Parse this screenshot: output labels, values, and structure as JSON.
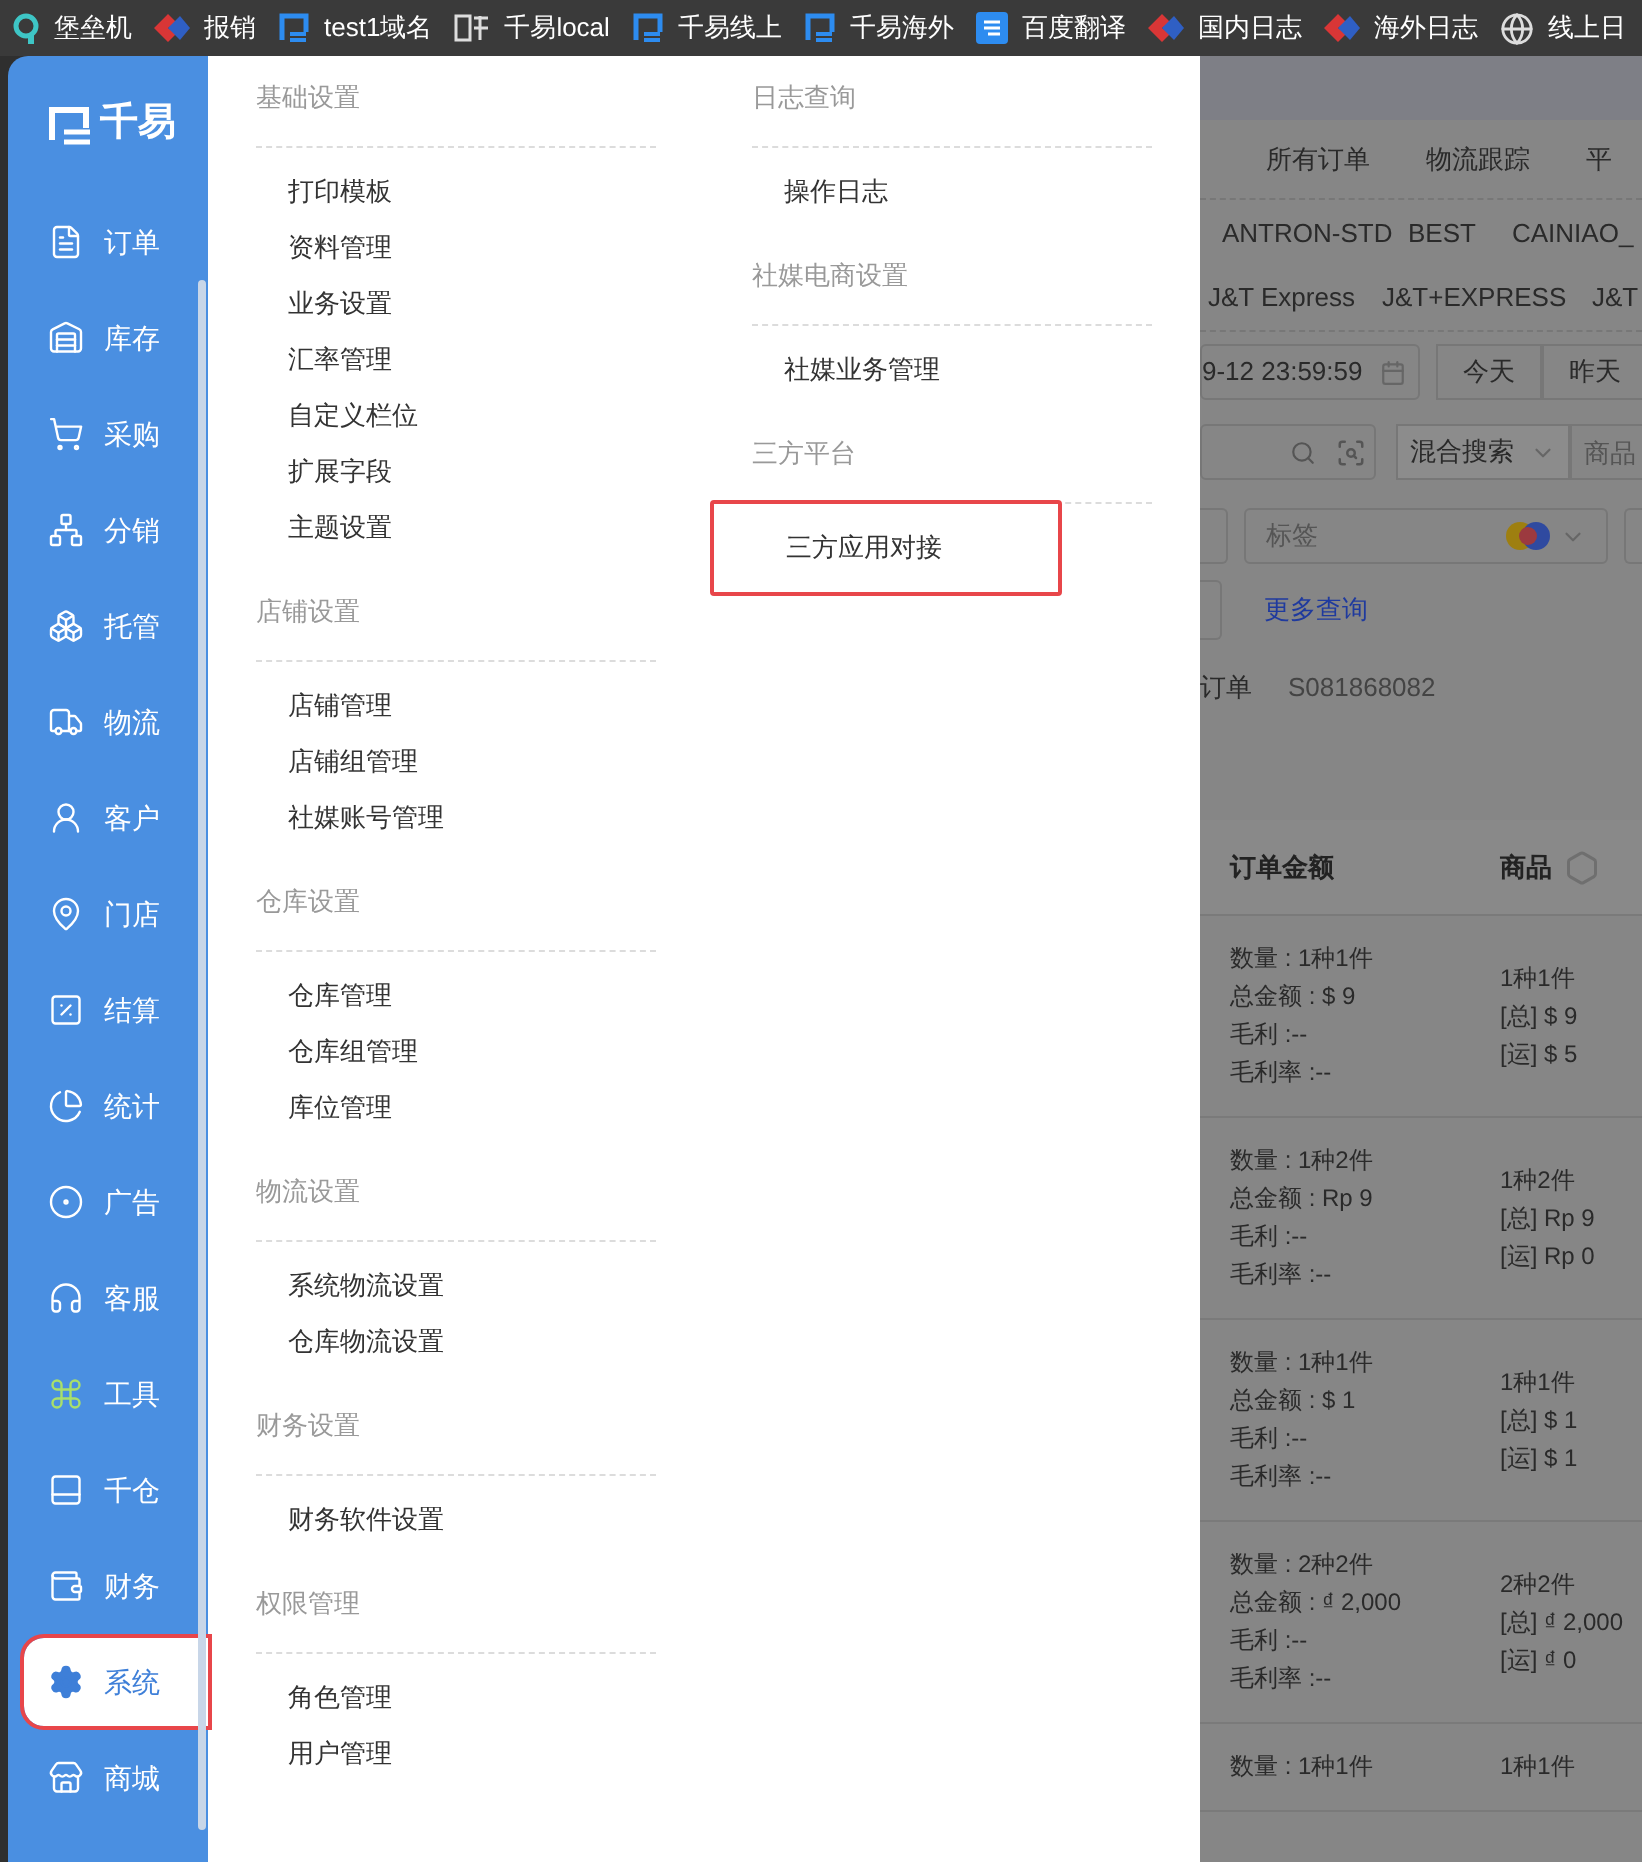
{
  "bookmarks": [
    {
      "label": "堡垒机"
    },
    {
      "label": "报销"
    },
    {
      "label": "test1域名"
    },
    {
      "label": "千易local"
    },
    {
      "label": "千易线上"
    },
    {
      "label": "千易海外"
    },
    {
      "label": "百度翻译"
    },
    {
      "label": "国内日志"
    },
    {
      "label": "海外日志"
    },
    {
      "label": "线上日"
    }
  ],
  "sidebar": {
    "logo": "千易",
    "items": [
      {
        "label": "订单",
        "selected": false,
        "highlighted": false
      },
      {
        "label": "库存",
        "selected": false,
        "highlighted": false
      },
      {
        "label": "采购",
        "selected": false,
        "highlighted": false
      },
      {
        "label": "分销",
        "selected": false,
        "highlighted": false
      },
      {
        "label": "托管",
        "selected": false,
        "highlighted": false
      },
      {
        "label": "物流",
        "selected": false,
        "highlighted": false
      },
      {
        "label": "客户",
        "selected": false,
        "highlighted": false
      },
      {
        "label": "门店",
        "selected": false,
        "highlighted": false
      },
      {
        "label": "结算",
        "selected": false,
        "highlighted": false
      },
      {
        "label": "统计",
        "selected": false,
        "highlighted": false
      },
      {
        "label": "广告",
        "selected": false,
        "highlighted": false
      },
      {
        "label": "客服",
        "selected": false,
        "highlighted": false
      },
      {
        "label": "工具",
        "selected": false,
        "highlighted": false
      },
      {
        "label": "千仓",
        "selected": false,
        "highlighted": false
      },
      {
        "label": "财务",
        "selected": false,
        "highlighted": false
      },
      {
        "label": "系统",
        "selected": true,
        "highlighted": true
      },
      {
        "label": "商城",
        "selected": false,
        "highlighted": false
      }
    ]
  },
  "menu": {
    "columns": [
      {
        "groups": [
          {
            "heading": "基础设置",
            "items": [
              {
                "label": "打印模板",
                "highlighted": false
              },
              {
                "label": "资料管理",
                "highlighted": false
              },
              {
                "label": "业务设置",
                "highlighted": false
              },
              {
                "label": "汇率管理",
                "highlighted": false
              },
              {
                "label": "自定义栏位",
                "highlighted": false
              },
              {
                "label": "扩展字段",
                "highlighted": false
              },
              {
                "label": "主题设置",
                "highlighted": false
              }
            ]
          },
          {
            "heading": "店铺设置",
            "items": [
              {
                "label": "店铺管理",
                "highlighted": false
              },
              {
                "label": "店铺组管理",
                "highlighted": false
              },
              {
                "label": "社媒账号管理",
                "highlighted": false
              }
            ]
          },
          {
            "heading": "仓库设置",
            "items": [
              {
                "label": "仓库管理",
                "highlighted": false
              },
              {
                "label": "仓库组管理",
                "highlighted": false
              },
              {
                "label": "库位管理",
                "highlighted": false
              }
            ]
          },
          {
            "heading": "物流设置",
            "items": [
              {
                "label": "系统物流设置",
                "highlighted": false
              },
              {
                "label": "仓库物流设置",
                "highlighted": false
              }
            ]
          },
          {
            "heading": "财务设置",
            "items": [
              {
                "label": "财务软件设置",
                "highlighted": false
              }
            ]
          },
          {
            "heading": "权限管理",
            "items": [
              {
                "label": "角色管理",
                "highlighted": false
              },
              {
                "label": "用户管理",
                "highlighted": false
              }
            ]
          }
        ]
      },
      {
        "groups": [
          {
            "heading": "日志查询",
            "items": [
              {
                "label": "操作日志",
                "highlighted": false
              }
            ]
          },
          {
            "heading": "社媒电商设置",
            "items": [
              {
                "label": "社媒业务管理",
                "highlighted": false
              }
            ]
          },
          {
            "heading": "三方平台",
            "items": [
              {
                "label": "三方应用对接",
                "highlighted": true
              }
            ]
          }
        ]
      }
    ]
  },
  "content": {
    "tabs": [
      "所有订单",
      "物流跟踪",
      "平"
    ],
    "carriers": [
      [
        "ANTRON-STD",
        "BEST",
        "CAINIAO_"
      ],
      [
        "J&T Express",
        "J&T+EXPRESS",
        "J&T"
      ]
    ],
    "date_field": {
      "value": "9-12 23:59:59"
    },
    "date_buttons": [
      "今天",
      "昨天"
    ],
    "search_mode": "混合搜索",
    "goods_field": {
      "placeholder": "商品"
    },
    "tag_select": {
      "placeholder": "标签"
    },
    "more_link": "更多查询",
    "order_label": "订单",
    "order_no": "S081868082",
    "table": {
      "columns": [
        "订单金额",
        "商品"
      ],
      "rows": [
        {
          "amount": [
            "数量 : 1种1件",
            "总金额 : $ 9",
            "毛利 :--",
            "毛利率 :--"
          ],
          "goods": [
            "1种1件",
            "[总] $ 9",
            "[运] $ 5"
          ]
        },
        {
          "amount": [
            "数量 : 1种2件",
            "总金额 : Rp 9",
            "毛利 :--",
            "毛利率 :--"
          ],
          "goods": [
            "1种2件",
            "[总] Rp 9",
            "[运] Rp 0"
          ]
        },
        {
          "amount": [
            "数量 : 1种1件",
            "总金额 : $ 1",
            "毛利 :--",
            "毛利率 :--"
          ],
          "goods": [
            "1种1件",
            "[总] $ 1",
            "[运] $ 1"
          ]
        },
        {
          "amount": [
            "数量 : 2种2件",
            "总金额 : ₫ 2,000",
            "毛利 :--",
            "毛利率 :--"
          ],
          "goods": [
            "2种2件",
            "[总] ₫ 2,000",
            "[运] ₫ 0"
          ]
        },
        {
          "amount": [
            "数量 : 1种1件"
          ],
          "goods": [
            "1种1件"
          ]
        }
      ]
    }
  }
}
